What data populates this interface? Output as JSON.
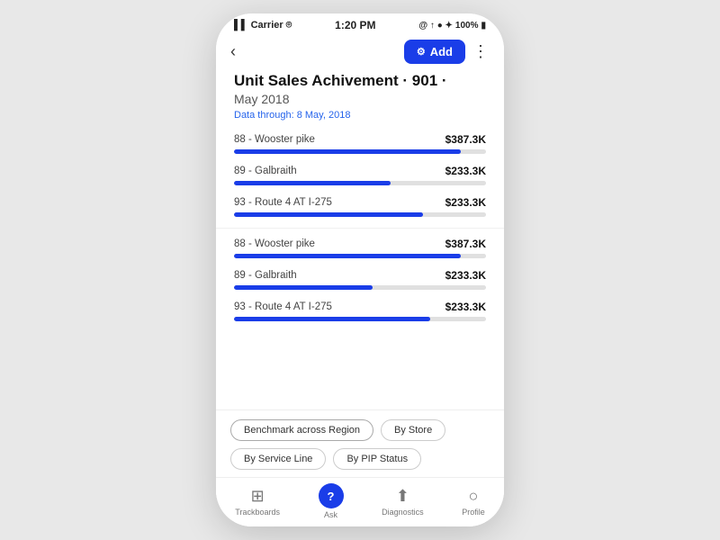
{
  "statusBar": {
    "carrier": "Carrier",
    "signal": "▌▌",
    "wifi": "⌾",
    "time": "1:20 PM",
    "icons": "@ ↑ ● ✦",
    "battery": "100%"
  },
  "navBar": {
    "backIcon": "‹",
    "addLabel": "Add",
    "moreIcon": "⋮"
  },
  "page": {
    "titlePrefix": "Unit Sales Achivement",
    "dot1": "·",
    "badgeNumber": "901",
    "dot2": "·",
    "subtitle": "May 2018",
    "dateThrough": "Data through: 8 May, 2018"
  },
  "barItems": [
    {
      "label": "88 - Wooster pike",
      "value": "$387.3K",
      "pct": 90
    },
    {
      "label": "89 - Galbraith",
      "value": "$233.3K",
      "pct": 62
    },
    {
      "label": "93 - Route 4 AT I-275",
      "value": "$233.3K",
      "pct": 75
    },
    {
      "label": "88 - Wooster pike",
      "value": "$387.3K",
      "pct": 90
    },
    {
      "label": "89 - Galbraith",
      "value": "$233.3K",
      "pct": 55
    },
    {
      "label": "93 - Route 4 AT I-275",
      "value": "$233.3K",
      "pct": 78
    }
  ],
  "filterButtons": [
    {
      "label": "Benchmark across Region",
      "active": true
    },
    {
      "label": "By Store",
      "active": false
    },
    {
      "label": "By Service Line",
      "active": false
    },
    {
      "label": "By PIP Status",
      "active": false
    }
  ],
  "bottomNav": [
    {
      "icon": "⊞",
      "label": "Trackboards"
    },
    {
      "icon": "?",
      "label": "Ask",
      "special": true
    },
    {
      "icon": "⬆",
      "label": "Diagnostics"
    },
    {
      "icon": "○",
      "label": "Profile"
    }
  ]
}
